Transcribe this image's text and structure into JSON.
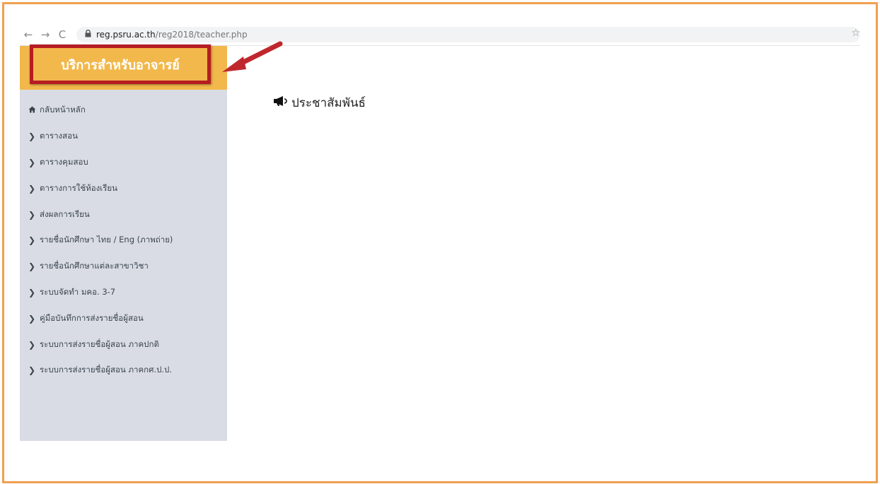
{
  "browser": {
    "back": "←",
    "forward": "→",
    "reload": "C",
    "url_domain": "reg.psru.ac.th",
    "url_path": "/reg2018/teacher.php",
    "lock_icon": "lock-icon",
    "bookmark_icon": "star-icon"
  },
  "sidebar": {
    "title": "บริการสำหรับอาจารย์",
    "items": [
      {
        "label": "กลับหน้าหลัก",
        "icon": "home-icon"
      },
      {
        "label": "ตารางสอน",
        "icon": "chevron-right-icon"
      },
      {
        "label": "ตารางคุมสอบ",
        "icon": "chevron-right-icon"
      },
      {
        "label": "ตารางการใช้ห้องเรียน",
        "icon": "chevron-right-icon"
      },
      {
        "label": "ส่งผลการเรียน",
        "icon": "chevron-right-icon"
      },
      {
        "label": "รายชื่อนักศึกษา ไทย / Eng (ภาพถ่าย)",
        "icon": "chevron-right-icon"
      },
      {
        "label": "รายชื่อนักศึกษาแต่ละสาขาวิชา",
        "icon": "chevron-right-icon"
      },
      {
        "label": "ระบบจัดทำ มคอ. 3-7",
        "icon": "chevron-right-icon"
      },
      {
        "label": "คู่มือบันทึกการส่งรายชื่อผู้สอน",
        "icon": "chevron-right-icon"
      },
      {
        "label": "ระบบการส่งรายชื่อผู้สอน ภาคปกติ",
        "icon": "chevron-right-icon"
      },
      {
        "label": "ระบบการส่งรายชื่อผู้สอน ภาคกศ.ป.ป.",
        "icon": "chevron-right-icon"
      }
    ]
  },
  "main": {
    "heading": "ประชาสัมพันธ์",
    "heading_icon": "megaphone-icon"
  },
  "colors": {
    "frame": "#f0a050",
    "sidebar_bg": "#d9dce4",
    "brand_bg": "#f2b84b",
    "highlight_border": "#b51d22",
    "arrow": "#c0272d"
  }
}
